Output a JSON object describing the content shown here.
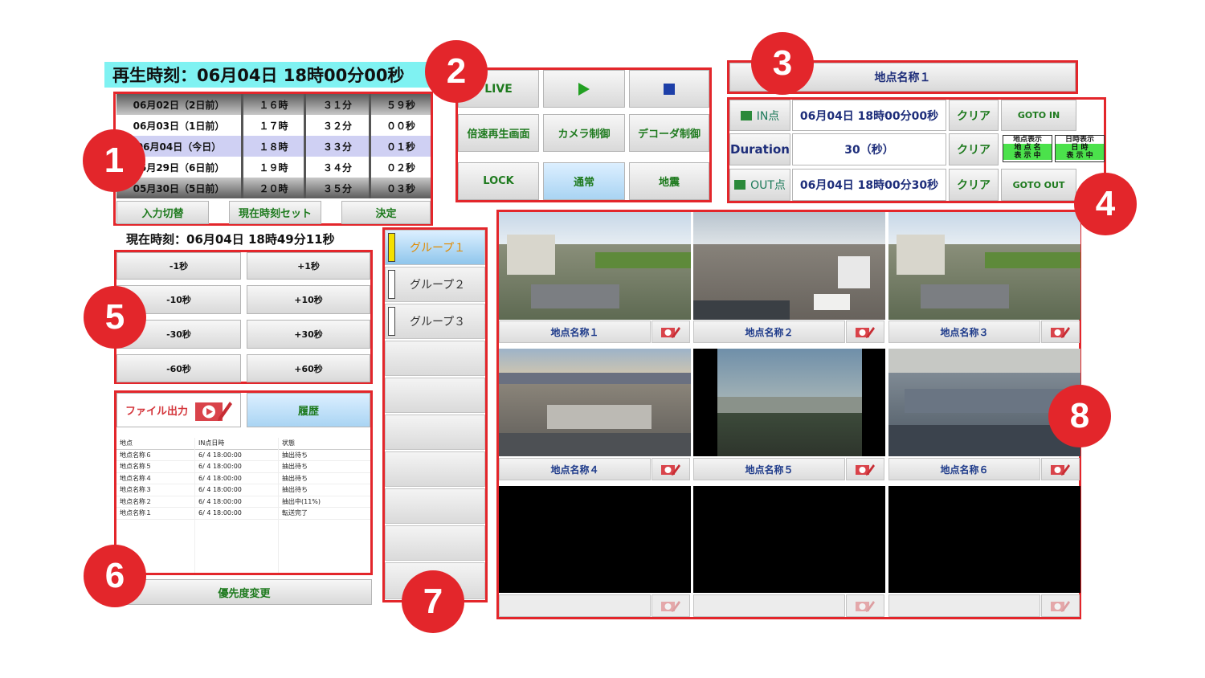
{
  "playback": {
    "label": "再生時刻：06月04日 18時00分00秒"
  },
  "roller": {
    "days": [
      "06月02日（2日前）",
      "06月03日（1日前）",
      "06月04日（今日）",
      "05月29日（6日前）",
      "05月30日（5日前）"
    ],
    "hours": [
      "１６時",
      "１７時",
      "１８時",
      "１９時",
      "２０時"
    ],
    "minutes": [
      "３１分",
      "３２分",
      "３３分",
      "３４分",
      "３５分"
    ],
    "seconds": [
      "５９秒",
      "００秒",
      "０１秒",
      "０２秒",
      "０３秒"
    ],
    "buttons": {
      "input_switch": "入力切替",
      "set_now": "現在時刻セット",
      "confirm": "決定"
    }
  },
  "current_time": {
    "label": "現在時刻：06月04日 18時49分11秒"
  },
  "playback_controls": {
    "live": "LIVE",
    "play_icon": "play-icon",
    "stop_icon": "stop-icon",
    "fast_play": "倍速再生画面",
    "camera_control": "カメラ制御",
    "decoder_control": "デコーダ制御",
    "lock": "LOCK",
    "normal": "通常",
    "earthquake": "地震"
  },
  "location_header": {
    "name": "地点名称１"
  },
  "in_out": {
    "in_label": "IN点",
    "in_time": "06月04日 18時00分00秒",
    "clear": "クリア",
    "goto_in": "GOTO IN",
    "duration_label": "Duration",
    "duration_value": "30（秒）",
    "location_display_title": "地点表示",
    "location_display_state": [
      "地 点 名",
      "表 示 中"
    ],
    "datetime_display_title": "日時表示",
    "datetime_display_state": [
      "日 時",
      "表 示 中"
    ],
    "out_label": "OUT点",
    "out_time": "06月04日 18時00分30秒",
    "goto_out": "GOTO OUT"
  },
  "adjust": {
    "minus1": "-1秒",
    "plus1": "+1秒",
    "minus10": "-10秒",
    "plus10": "+10秒",
    "minus30": "-30秒",
    "plus30": "+30秒",
    "minus60": "-60秒",
    "plus60": "+60秒"
  },
  "file_output": {
    "output_label": "ファイル出力",
    "history_label": "履歴",
    "columns": [
      "地点",
      "IN点日時",
      "状態"
    ],
    "rows": [
      [
        "地点名称６",
        "6/ 4 18:00:00",
        "抽出待ち"
      ],
      [
        "地点名称５",
        "6/ 4 18:00:00",
        "抽出待ち"
      ],
      [
        "地点名称４",
        "6/ 4 18:00:00",
        "抽出待ち"
      ],
      [
        "地点名称３",
        "6/ 4 18:00:00",
        "抽出待ち"
      ],
      [
        "地点名称２",
        "6/ 4 18:00:00",
        "抽出中(11%)"
      ],
      [
        "地点名称１",
        "6/ 4 18:00:00",
        "転送完了"
      ]
    ],
    "priority_button": "優先度変更"
  },
  "groups": [
    "グループ１",
    "グループ２",
    "グループ３"
  ],
  "cameras": [
    {
      "name": "地点名称１"
    },
    {
      "name": "地点名称２"
    },
    {
      "name": "地点名称３"
    },
    {
      "name": "地点名称４"
    },
    {
      "name": "地点名称５"
    },
    {
      "name": "地点名称６"
    },
    {
      "name": ""
    },
    {
      "name": ""
    },
    {
      "name": ""
    }
  ],
  "badges": [
    "1",
    "2",
    "3",
    "4",
    "5",
    "6",
    "7",
    "8"
  ],
  "colors": {
    "annotation_red": "#e3262b",
    "title_bg": "#7ff2f2",
    "active_green": "#4be24b"
  }
}
